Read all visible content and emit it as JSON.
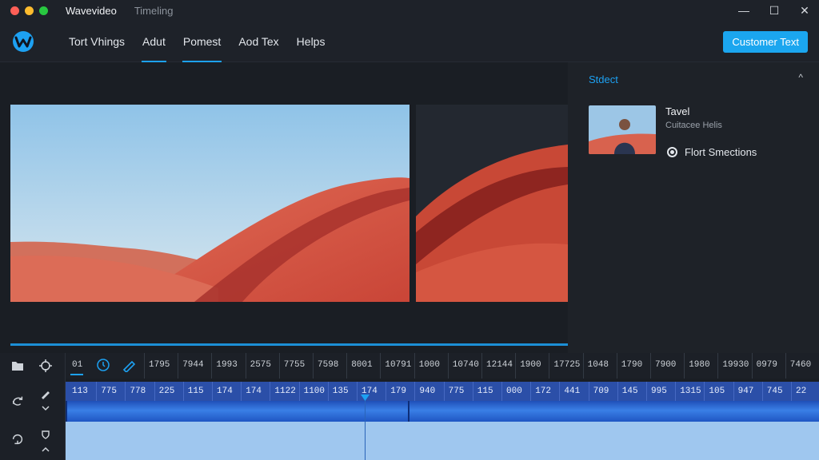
{
  "window": {
    "app_name": "Wavevideo",
    "doc_name": "Timeling",
    "traffic_colors": [
      "#ff5f57",
      "#febc2e",
      "#28c840"
    ],
    "controls": {
      "minimize": "—",
      "maximize": "☐",
      "close": "✕"
    }
  },
  "nav": {
    "logo_icon": "wavevideo-logo-icon",
    "items": [
      {
        "label": "Tort Vhings",
        "active": false
      },
      {
        "label": "Adut",
        "active": true
      },
      {
        "label": "Pomest",
        "active": true
      },
      {
        "label": "Aod Tex",
        "active": false
      },
      {
        "label": "Helps",
        "active": false
      }
    ],
    "cta_label": "Customer Text"
  },
  "side_panel": {
    "title": "Stdect",
    "chevron": "^",
    "media": {
      "title": "Tavel",
      "subtitle": "Cuitacee Helis"
    },
    "option_label": "Flort Smections"
  },
  "timeline": {
    "tools": {
      "row1": [
        "folder-icon",
        "crosshair-icon"
      ],
      "row2": [
        "swap-icon",
        "pen-icon"
      ],
      "row3": [
        "loop-icon",
        "down-icon"
      ]
    },
    "ruler_start_label": "01",
    "ruler_labels": [
      "1795",
      "7944",
      "1993",
      "2575",
      "7755",
      "7598",
      "8001",
      "10791",
      "1000",
      "10740",
      "12144",
      "1900",
      "17725",
      "1048",
      "1790",
      "7900",
      "1980",
      "19930",
      "0979",
      "7460"
    ],
    "track_labels": [
      "113",
      "775",
      "778",
      "225",
      "115",
      "174",
      "174",
      "1122",
      "1100",
      "135",
      "174",
      "179",
      "940",
      "775",
      "115",
      "000",
      "172",
      "441",
      "709",
      "145",
      "995",
      "1315",
      "105",
      "947",
      "745",
      "22"
    ],
    "accent": "#1da1f2"
  }
}
